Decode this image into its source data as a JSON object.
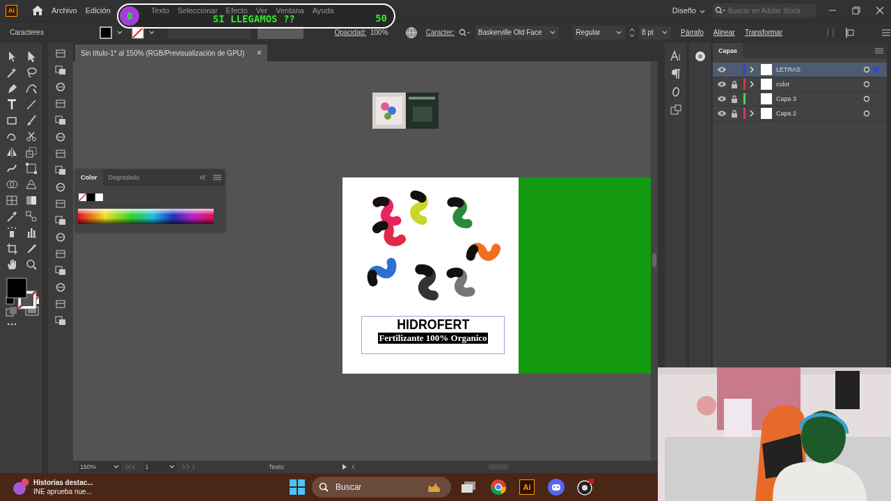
{
  "app_logo": "Ai",
  "menu": [
    {
      "label": "Archivo"
    },
    {
      "label": "Edición"
    },
    {
      "label": "Texto"
    },
    {
      "label": "Seleccionar"
    },
    {
      "label": "Efecto"
    },
    {
      "label": "Ver"
    },
    {
      "label": "Ventana"
    },
    {
      "label": "Ayuda"
    }
  ],
  "workspace": "Diseño",
  "stock_search": {
    "placeholder": "Buscar en Adobe Stock"
  },
  "control_bar": {
    "panel_label": "Caracteres",
    "opacity_label": "Opacidad:",
    "opacity": "100%",
    "character_label": "Caracter:",
    "font": "Baskerville Old Face",
    "style": "Regular",
    "size": "8 pt",
    "links": [
      "Párrafo",
      "Alinear",
      "Transformar"
    ]
  },
  "document_tab": {
    "title": "Sin título-1* al 150% (RGB/Previsualización de GPU)",
    "close": "×"
  },
  "color_panel": {
    "tabs": [
      {
        "label": "Color",
        "selected": true
      },
      {
        "label": "Degradado",
        "selected": false
      }
    ]
  },
  "artboard": {
    "title": "HIDROFERT",
    "subtitle": "Fertilizante 100% Organico"
  },
  "layers": {
    "tab": "Capas",
    "items": [
      {
        "name": "LETRAS",
        "color": "#3346d6",
        "selected": true,
        "locked": false,
        "expandable": true
      },
      {
        "name": "color",
        "color": "#d63a3a",
        "selected": false,
        "locked": true,
        "expandable": true
      },
      {
        "name": "Capa 3",
        "color": "#4fd64a",
        "selected": false,
        "locked": true,
        "expandable": false
      },
      {
        "name": "Capa 2",
        "color": "#d6365c",
        "selected": false,
        "locked": true,
        "expandable": true
      }
    ]
  },
  "status_bar": {
    "zoom": "150%",
    "artboard": "1",
    "tool": "Texto"
  },
  "stream_goal": {
    "title": "SI LLEGAMOS ??",
    "start": "0",
    "goal": "50",
    "level": 0.0
  },
  "taskbar": {
    "news_title": "Historias destac...",
    "news_subtitle": "INE aprueba nue...",
    "search": {
      "placeholder": "Buscar"
    },
    "app_logo": "Ai"
  }
}
